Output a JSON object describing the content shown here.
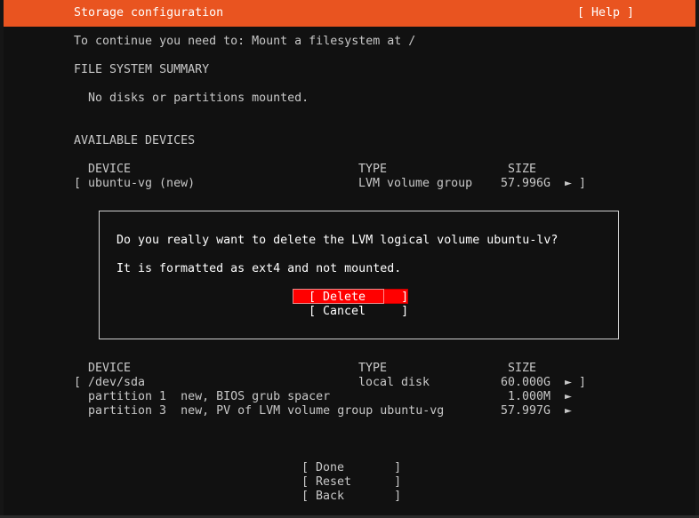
{
  "header": {
    "title": "Storage configuration",
    "help": "[ Help ]"
  },
  "instruction": "To continue you need to: Mount a filesystem at /",
  "fs_summary": {
    "heading": "FILE SYSTEM SUMMARY",
    "empty_text": "No disks or partitions mounted."
  },
  "available": {
    "heading": "AVAILABLE DEVICES",
    "columns": {
      "device": "DEVICE",
      "type": "TYPE",
      "size": "SIZE"
    },
    "vg_row": {
      "bracket_open": "[",
      "device": "ubuntu-vg (new)",
      "type": "LVM volume group",
      "size": "57.996G",
      "arrow": "►",
      "bracket_close": "]"
    },
    "disk_row": {
      "bracket_open": "[",
      "device": "/dev/sda",
      "type": "local disk",
      "size": "60.000G",
      "arrow": "►",
      "bracket_close": "]"
    },
    "partitions": [
      {
        "label": "partition 1  new, BIOS grub spacer",
        "size": "1.000M",
        "arrow": "►"
      },
      {
        "label": "partition 3  new, PV of LVM volume group ubuntu-vg",
        "size": "57.997G",
        "arrow": "►"
      }
    ]
  },
  "dialog": {
    "question": "Do you really want to delete the LVM logical volume ubuntu-lv?",
    "detail": "It is formatted as ext4 and not mounted.",
    "delete_label": "[ Delete     ]",
    "cancel_label": "[ Cancel     ]"
  },
  "actions": {
    "done": "[ Done       ]",
    "reset": "[ Reset      ]",
    "back": "[ Back       ]"
  },
  "colors": {
    "accent": "#e95420",
    "focus": "#ff0000",
    "background": "#111111"
  }
}
